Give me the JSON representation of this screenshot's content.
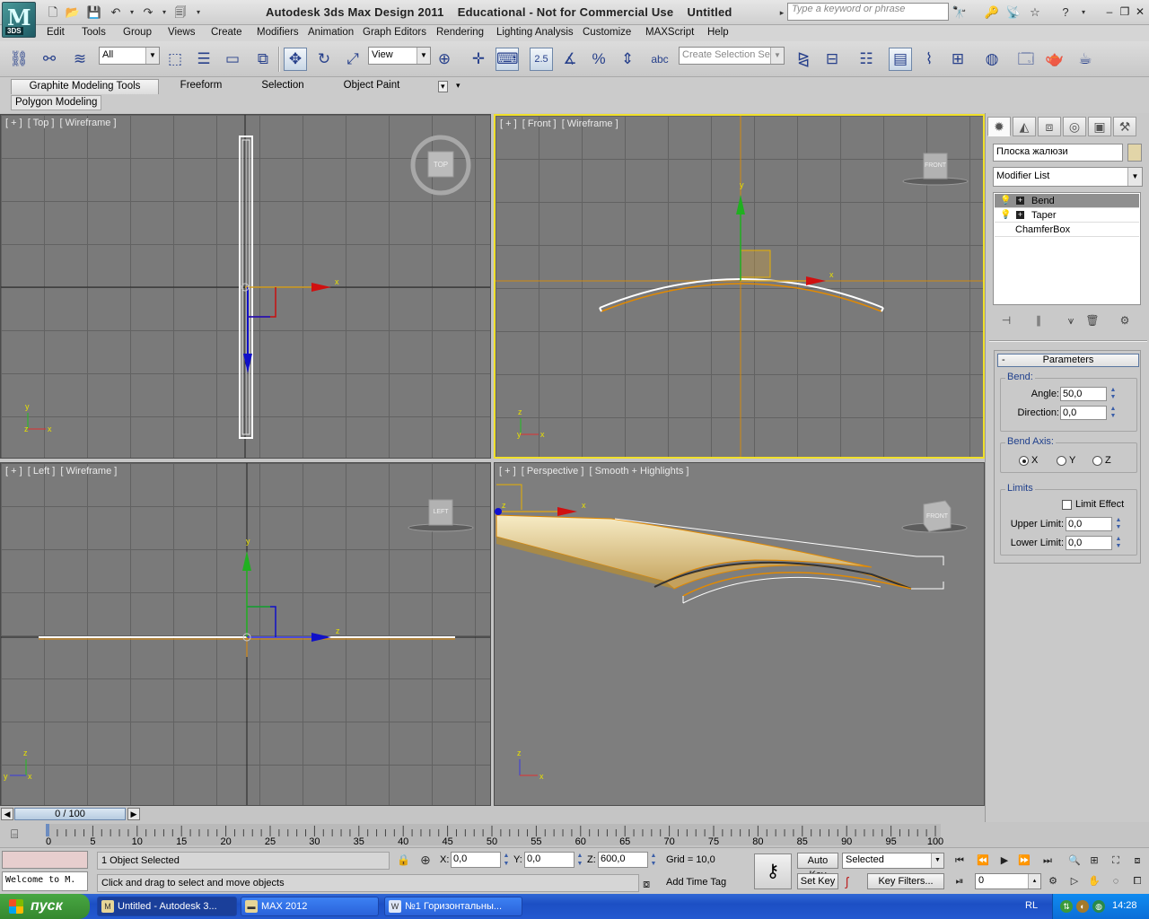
{
  "app": {
    "logo_tag": "3DS",
    "title": "Autodesk 3ds Max Design 2011    Educational - Not for Commercial Use    Untitled",
    "search_placeholder": "Type a keyword or phrase"
  },
  "menu": [
    "Edit",
    "Tools",
    "Group",
    "Views",
    "Create",
    "Modifiers",
    "Animation",
    "Graph Editors",
    "Rendering",
    "Lighting Analysis",
    "Customize",
    "MAXScript",
    "Help"
  ],
  "toolbar": {
    "selection_filter": "All",
    "ref_coord": "View",
    "snap_value": "2.5",
    "named_selection_placeholder": "Create Selection Se"
  },
  "ribbon": {
    "tabs": [
      "Graphite Modeling Tools",
      "Freeform",
      "Selection",
      "Object Paint"
    ],
    "subtab": "Polygon Modeling"
  },
  "viewports": {
    "top": {
      "labels": [
        "[ + ]",
        "[ Top ]",
        "[ Wireframe ]"
      ],
      "cube": "TOP"
    },
    "front": {
      "labels": [
        "[ + ]",
        "[ Front ]",
        "[ Wireframe ]"
      ],
      "cube": "FRONT"
    },
    "left": {
      "labels": [
        "[ + ]",
        "[ Left ]",
        "[ Wireframe ]"
      ],
      "cube": "LEFT"
    },
    "perspective": {
      "labels": [
        "[ + ]",
        "[ Perspective ]",
        "[ Smooth + Highlights ]"
      ],
      "cube": "FRONT"
    },
    "axis": {
      "x": "x",
      "y": "y",
      "z": "z"
    }
  },
  "command_panel": {
    "object_name": "Плоска жалюзи",
    "object_color": "#e2d5a8",
    "modifier_list": "Modifier List",
    "stack": [
      {
        "label": "Bend",
        "selected": true,
        "expandable": true
      },
      {
        "label": "Taper",
        "selected": false,
        "expandable": true
      },
      {
        "label": "ChamferBox",
        "selected": false,
        "expandable": false
      }
    ],
    "parameters": {
      "title": "Parameters",
      "bend_group": "Bend:",
      "angle_label": "Angle:",
      "angle": "50,0",
      "direction_label": "Direction:",
      "direction": "0,0",
      "bend_axis_group": "Bend Axis:",
      "axis_options": [
        "X",
        "Y",
        "Z"
      ],
      "axis_selected": "X",
      "limits_group": "Limits",
      "limit_effect": "Limit Effect",
      "upper_label": "Upper Limit:",
      "upper": "0,0",
      "lower_label": "Lower Limit:",
      "lower": "0,0"
    }
  },
  "timeline": {
    "frame_display": "0 / 100",
    "ticks": [
      "0",
      "5",
      "10",
      "15",
      "20",
      "25",
      "30",
      "35",
      "40",
      "45",
      "50",
      "55",
      "60",
      "65",
      "70",
      "75",
      "80",
      "85",
      "90",
      "95",
      "100"
    ]
  },
  "status": {
    "listener_text": "Welcome to M.",
    "selection_count": "1 Object Selected",
    "prompt": "Click and drag to select and move objects",
    "x_label": "X:",
    "x": "0,0",
    "y_label": "Y:",
    "y": "0,0",
    "z_label": "Z:",
    "z": "600,0",
    "grid": "Grid = 10,0",
    "add_time_tag": "Add Time Tag",
    "auto_key": "Auto Key",
    "set_key": "Set Key",
    "key_mode": "Selected",
    "key_filters": "Key Filters...",
    "current_frame": "0"
  },
  "taskbar": {
    "start": "пуск",
    "tasks": [
      "Untitled - Autodesk 3...",
      "MAX 2012",
      "№1 Горизонтальны..."
    ],
    "lang": "RL",
    "clock": "14:28"
  }
}
